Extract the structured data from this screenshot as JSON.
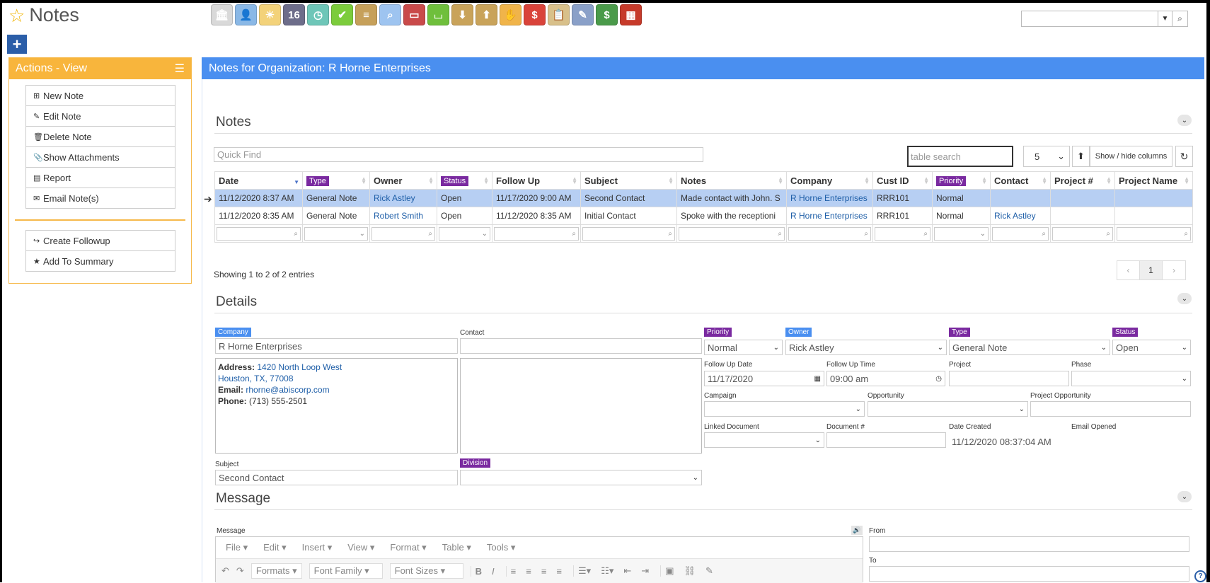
{
  "app": {
    "title": "Notes"
  },
  "toolbar": {
    "icons": [
      {
        "name": "bank-icon",
        "glyph": "🏛",
        "color": "#d9d9d9"
      },
      {
        "name": "user-icon",
        "glyph": "👤",
        "color": "#8ab8e6"
      },
      {
        "name": "weather-icon",
        "glyph": "☀",
        "color": "#f3d27a"
      },
      {
        "name": "calendar-icon",
        "glyph": "16",
        "color": "#6d6d8a"
      },
      {
        "name": "clock-icon",
        "glyph": "◷",
        "color": "#6ec6b8"
      },
      {
        "name": "checkmark-icon",
        "glyph": "✔",
        "color": "#7ccc3c"
      },
      {
        "name": "document-list-icon",
        "glyph": "≡",
        "color": "#c6a05a"
      },
      {
        "name": "magnifier-icon",
        "glyph": "⌕",
        "color": "#9ec4f0"
      },
      {
        "name": "bus-icon",
        "glyph": "▭",
        "color": "#c94a4a"
      },
      {
        "name": "basket-icon",
        "glyph": "⌴",
        "color": "#6fbf3c"
      },
      {
        "name": "download-box-icon",
        "glyph": "⬇",
        "color": "#c9a35a"
      },
      {
        "name": "upload-box-icon",
        "glyph": "⬆",
        "color": "#c9a35a"
      },
      {
        "name": "money-hand-icon",
        "glyph": "✋",
        "color": "#f0b44a"
      },
      {
        "name": "dollar-bubble-icon",
        "glyph": "$",
        "color": "#d9433a"
      },
      {
        "name": "clipboard-icon",
        "glyph": "📋",
        "color": "#d8c08a"
      },
      {
        "name": "pencil-icon",
        "glyph": "✎",
        "color": "#8aa0c8"
      },
      {
        "name": "cash-icon",
        "glyph": "$",
        "color": "#4a9a4a"
      },
      {
        "name": "building-icon",
        "glyph": "▦",
        "color": "#c63a2a"
      }
    ]
  },
  "sidebar": {
    "header": "Actions - View",
    "items": [
      {
        "name": "new-note",
        "icon": "plus-square-icon",
        "glyph": "⊞",
        "label": "New Note"
      },
      {
        "name": "edit-note",
        "icon": "pencil-icon",
        "glyph": "✎",
        "label": "Edit Note"
      },
      {
        "name": "delete-note",
        "icon": "trash-icon",
        "glyph": "🗑",
        "label": "Delete Note"
      },
      {
        "name": "show-attachments",
        "icon": "paperclip-icon",
        "glyph": "📎",
        "label": "Show Attachments"
      },
      {
        "name": "report",
        "icon": "file-icon",
        "glyph": "▤",
        "label": "Report"
      },
      {
        "name": "email-notes",
        "icon": "envelope-icon",
        "glyph": "✉",
        "label": "Email Note(s)"
      }
    ],
    "items2": [
      {
        "name": "create-followup",
        "icon": "share-icon",
        "glyph": "↪",
        "label": "Create Followup"
      },
      {
        "name": "add-to-summary",
        "icon": "star-icon",
        "glyph": "★",
        "label": "Add To Summary"
      }
    ]
  },
  "main": {
    "header": "Notes for Organization: R Horne Enterprises"
  },
  "notes": {
    "section_title": "Notes",
    "quick_find_placeholder": "Quick Find",
    "table_search_placeholder": "table search",
    "page_size": "5",
    "show_hide_label": "Show / hide columns",
    "columns": [
      "Date",
      "Type",
      "Owner",
      "Status",
      "Follow Up",
      "Subject",
      "Notes",
      "Company",
      "Cust ID",
      "Priority",
      "Contact",
      "Project #",
      "Project Name"
    ],
    "rows": [
      [
        "11/12/2020 8:37 AM",
        "General Note",
        "Rick Astley",
        "Open",
        "11/17/2020 9:00 AM",
        "Second Contact",
        "Made contact with John. S",
        "R Horne Enterprises",
        "RRR101",
        "Normal",
        "",
        "",
        ""
      ],
      [
        "11/12/2020 8:35 AM",
        "General Note",
        "Robert Smith",
        "Open",
        "11/12/2020 8:35 AM",
        "Initial Contact",
        "Spoke with the receptioni",
        "R Horne Enterprises",
        "RRR101",
        "Normal",
        "Rick Astley",
        "",
        ""
      ]
    ],
    "showing": "Showing 1 to 2 of 2 entries",
    "pager": {
      "prev": "‹",
      "page": "1",
      "next": "›"
    }
  },
  "details": {
    "section_title": "Details",
    "company_label": "Company",
    "company_value": "R Horne Enterprises",
    "contact_label": "Contact",
    "address_label": "Address:",
    "address_line1": "1420 North Loop West",
    "address_line2": "Houston, TX, 77008",
    "email_label": "Email:",
    "email_value": "rhorne@abiscorp.com",
    "phone_label": "Phone:",
    "phone_value": "(713) 555-2501",
    "priority_label": "Priority",
    "priority_value": "Normal",
    "owner_label": "Owner",
    "owner_value": "Rick Astley",
    "type_label": "Type",
    "type_value": "General Note",
    "status_label": "Status",
    "status_value": "Open",
    "followup_date_label": "Follow Up Date",
    "followup_date_value": "11/17/2020",
    "followup_time_label": "Follow Up Time",
    "followup_time_value": "09:00 am",
    "project_label": "Project",
    "phase_label": "Phase",
    "campaign_label": "Campaign",
    "opportunity_label": "Opportunity",
    "project_opportunity_label": "Project Opportunity",
    "linked_document_label": "Linked Document",
    "document_number_label": "Document #",
    "date_created_label": "Date Created",
    "date_created_value": "11/12/2020 08:37:04 AM",
    "email_opened_label": "Email Opened",
    "subject_label": "Subject",
    "subject_value": "Second Contact",
    "division_label": "Division"
  },
  "message": {
    "section_title": "Message",
    "message_label": "Message",
    "from_label": "From",
    "to_label": "To",
    "menu": [
      "File",
      "Edit",
      "Insert",
      "View",
      "Format",
      "Table",
      "Tools"
    ],
    "formats": "Formats",
    "font_family": "Font Family",
    "font_sizes": "Font Sizes"
  },
  "colors": {
    "accent_blue": "#4a8ff0",
    "actions_orange": "#f8b53c",
    "pill_purple": "#7a2aa0",
    "selected_row": "#b7cff3"
  }
}
